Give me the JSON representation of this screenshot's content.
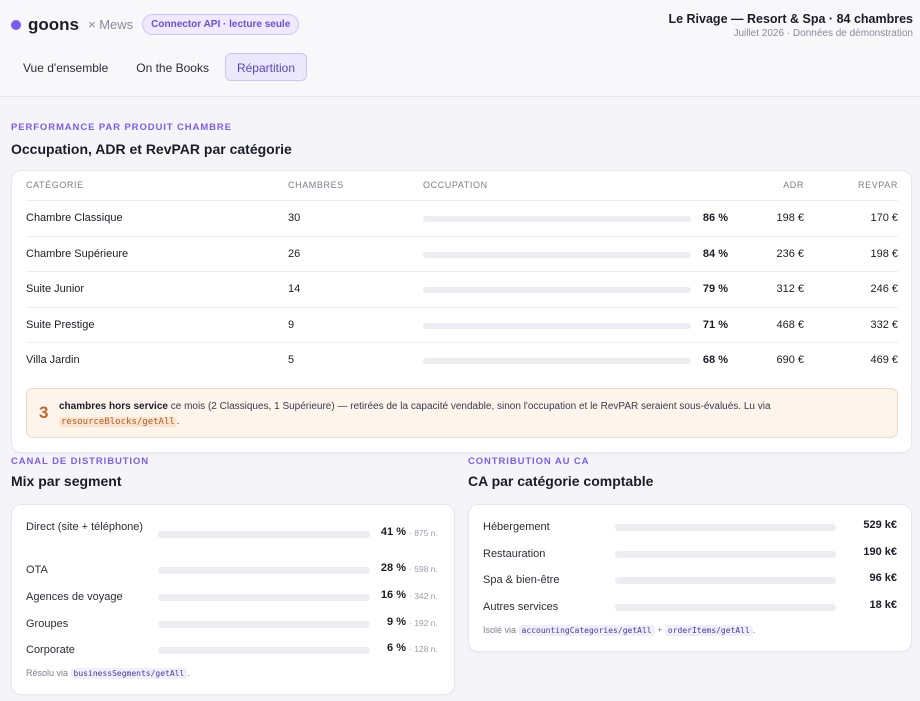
{
  "header": {
    "brand": "goons",
    "partner": "× Mews",
    "connector_badge": "Connector API · lecture seule",
    "hotel_title": "Le Rivage — Resort & Spa · 84 chambres",
    "hotel_sub": "Juillet 2026 · Données de démonstration",
    "tabs": [
      {
        "label": "Vue d'ensemble",
        "active": false
      },
      {
        "label": "On the Books",
        "active": false
      },
      {
        "label": "Répartition",
        "active": true
      }
    ]
  },
  "rooms": {
    "eyebrow": "PERFORMANCE PAR PRODUIT CHAMBRE",
    "title": "Occupation, ADR et RevPAR par catégorie",
    "columns": {
      "category": "CATÉGORIE",
      "rooms": "CHAMBRES",
      "occupation": "OCCUPATION",
      "adr": "ADR",
      "revpar": "REVPAR"
    },
    "rows": [
      {
        "category": "Chambre Classique",
        "rooms": "30",
        "occupation": "86 %",
        "occ_value": 86,
        "adr": "198 €",
        "revpar": "170 €"
      },
      {
        "category": "Chambre Supérieure",
        "rooms": "26",
        "occupation": "84 %",
        "occ_value": 84,
        "adr": "236 €",
        "revpar": "198 €"
      },
      {
        "category": "Suite Junior",
        "rooms": "14",
        "occupation": "79 %",
        "occ_value": 79,
        "adr": "312 €",
        "revpar": "246 €"
      },
      {
        "category": "Suite Prestige",
        "rooms": "9",
        "occupation": "71 %",
        "occ_value": 71,
        "adr": "468 €",
        "revpar": "332 €"
      },
      {
        "category": "Villa Jardin",
        "rooms": "5",
        "occupation": "68 %",
        "occ_value": 68,
        "adr": "690 €",
        "revpar": "469 €"
      }
    ],
    "note": {
      "number": "3",
      "bold": "chambres hors service",
      "text": " ce mois (2 Classiques, 1 Supérieure) — retirées de la capacité vendable, sinon l'occupation et le RevPAR seraient sous-évalués. Lu via ",
      "code": "resourceBlocks/getAll",
      "end": "."
    }
  },
  "segments": {
    "eyebrow": "CANAL DE DISTRIBUTION",
    "title": "Mix par segment",
    "rows": [
      {
        "label": "Direct (site + téléphone)",
        "pct": "41 %",
        "value": 41,
        "count": "· 875 n."
      },
      {
        "label": "OTA",
        "pct": "28 %",
        "value": 28,
        "count": "· 598 n."
      },
      {
        "label": "Agences de voyage",
        "pct": "16 %",
        "value": 16,
        "count": "· 342 n."
      },
      {
        "label": "Groupes",
        "pct": "9 %",
        "value": 9,
        "count": "· 192 n."
      },
      {
        "label": "Corporate",
        "pct": "6 %",
        "value": 6,
        "count": "· 128 n."
      }
    ],
    "footer_prefix": "Résolu via",
    "footer_code": "businessSegments/getAll",
    "footer_end": "."
  },
  "accounting": {
    "eyebrow": "CONTRIBUTION AU CA",
    "title": "CA par catégorie comptable",
    "rows": [
      {
        "label": "Hébergement",
        "amount": "529 k€",
        "value": 529
      },
      {
        "label": "Restauration",
        "amount": "190 k€",
        "value": 190
      },
      {
        "label": "Spa & bien-être",
        "amount": "96 k€",
        "value": 96
      },
      {
        "label": "Autres services",
        "amount": "18 k€",
        "value": 18
      }
    ],
    "footer_prefix": "Isolé via",
    "footer_code_1": "accountingCategories/getAll",
    "footer_plus": "+",
    "footer_code_2": "orderItems/getAll",
    "footer_end": "."
  },
  "colors": {
    "accent": "#7c5cf0",
    "warning": "#c2662a",
    "bar_track": "#ececf1"
  }
}
